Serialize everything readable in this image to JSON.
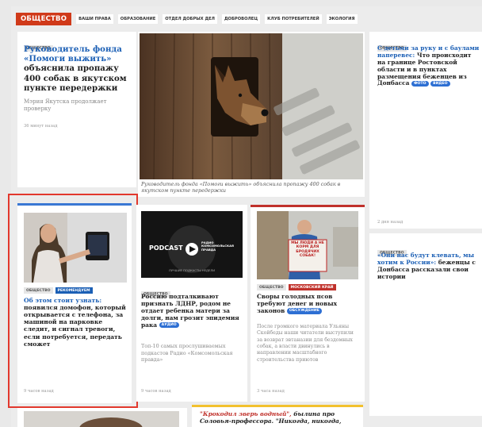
{
  "nav": {
    "section": "ОБЩЕСТВО",
    "items": [
      "ВАШИ ПРАВА",
      "ОБРАЗОВАНИЕ",
      "ОТДЕЛ ДОБРЫХ ДЕЛ",
      "ДОБРОВОЛЕЦ",
      "КЛУБ ПОТРЕБИТЕЛЕЙ",
      "ЭКОЛОГИЯ"
    ]
  },
  "main_article": {
    "tag": "ОБЩЕСТВО",
    "title_highlight": "Руководитель фонда «Помоги выжить»",
    "title_rest": "объяснила пропажу 400 собак в якутском пункте передержки",
    "lead": "Мэрия Якутска продолжает проверку",
    "time": "36 минут назад",
    "image_caption": "Руководитель фонда «Помоги выжить» объяснила пропажу 400 собак в якутском пункте передержки"
  },
  "side_article_1": {
    "tag": "ОБЩЕСТВО",
    "title_highlight": "С детьми за руку и с баулами наперевес:",
    "title_rest": "Что происходит на границе Ростовской области и в пунктах размещения беженцев из Донбасса",
    "badges": [
      "ФОТО",
      "ВИДЕО"
    ],
    "time": "2 дня назад"
  },
  "side_article_2": {
    "tag": "ОБЩЕСТВО",
    "title_highlight": "«Они нас будут клевать, мы хотим к России»:",
    "title_rest": "беженцы с Донбасса рассказали свои истории"
  },
  "intercom_article": {
    "tags": [
      "ОБЩЕСТВО",
      "РЕКОМЕНДУЕМ"
    ],
    "title_highlight": "Об этом стоит узнать:",
    "title_rest": "появился домофон, который открывается с телефона, за машиной на парковке следит, и сигнал тревоги, если потребуется, передать сможет",
    "time": "9 часов назад"
  },
  "podcast_article": {
    "tag": "ОБЩЕСТВО",
    "title": "Россию подталкивают признать ЛДНР, родом не отдает ребенка матери за долги, нам грозит эпидемия рака",
    "badge": "АУДИО",
    "lead": "Топ-10 самых прослушиваемых подкастов Радио «Комсомольская правда»",
    "time": "9 часов назад",
    "image_title": "PODCAST",
    "image_radio_1": "РАДИО",
    "image_radio_2": "КОМСОМОЛЬСКАЯ",
    "image_radio_3": "ПРАВДА",
    "image_sub": "ЛУЧШИЕ ПОДКАСТЫ НЕДЕЛИ"
  },
  "dogs_article": {
    "tags": [
      "ОБЩЕСТВО",
      "МОСКОВСКИЙ КРАЙ"
    ],
    "title": "Своры голодных псов требуют денег и новых законов",
    "badge": "ОБСУЖДЕНИЕ",
    "lead": "После громкого материала Ульяны Скойбеды наши читатели выступили за возврат эвтаназии для бездомных собак, а власти двинулись в направлении масштабного строительства приютов",
    "time": "3 часа назад",
    "sign_text": "МЫ ЛЮДИ А НЕ КОРМ ДЛЯ БРОДЯЧИХ СОБАК!"
  },
  "bottom_article": {
    "title_highlight": "\"Крокодил зверь водный\",",
    "title_rest": "былина про Соловья-профессора. \"Никогда, никогда,"
  },
  "colors": {
    "accent_red": "#d03a1a",
    "link_blue": "#1b5fb5",
    "highlight_box": "#e2382d"
  }
}
